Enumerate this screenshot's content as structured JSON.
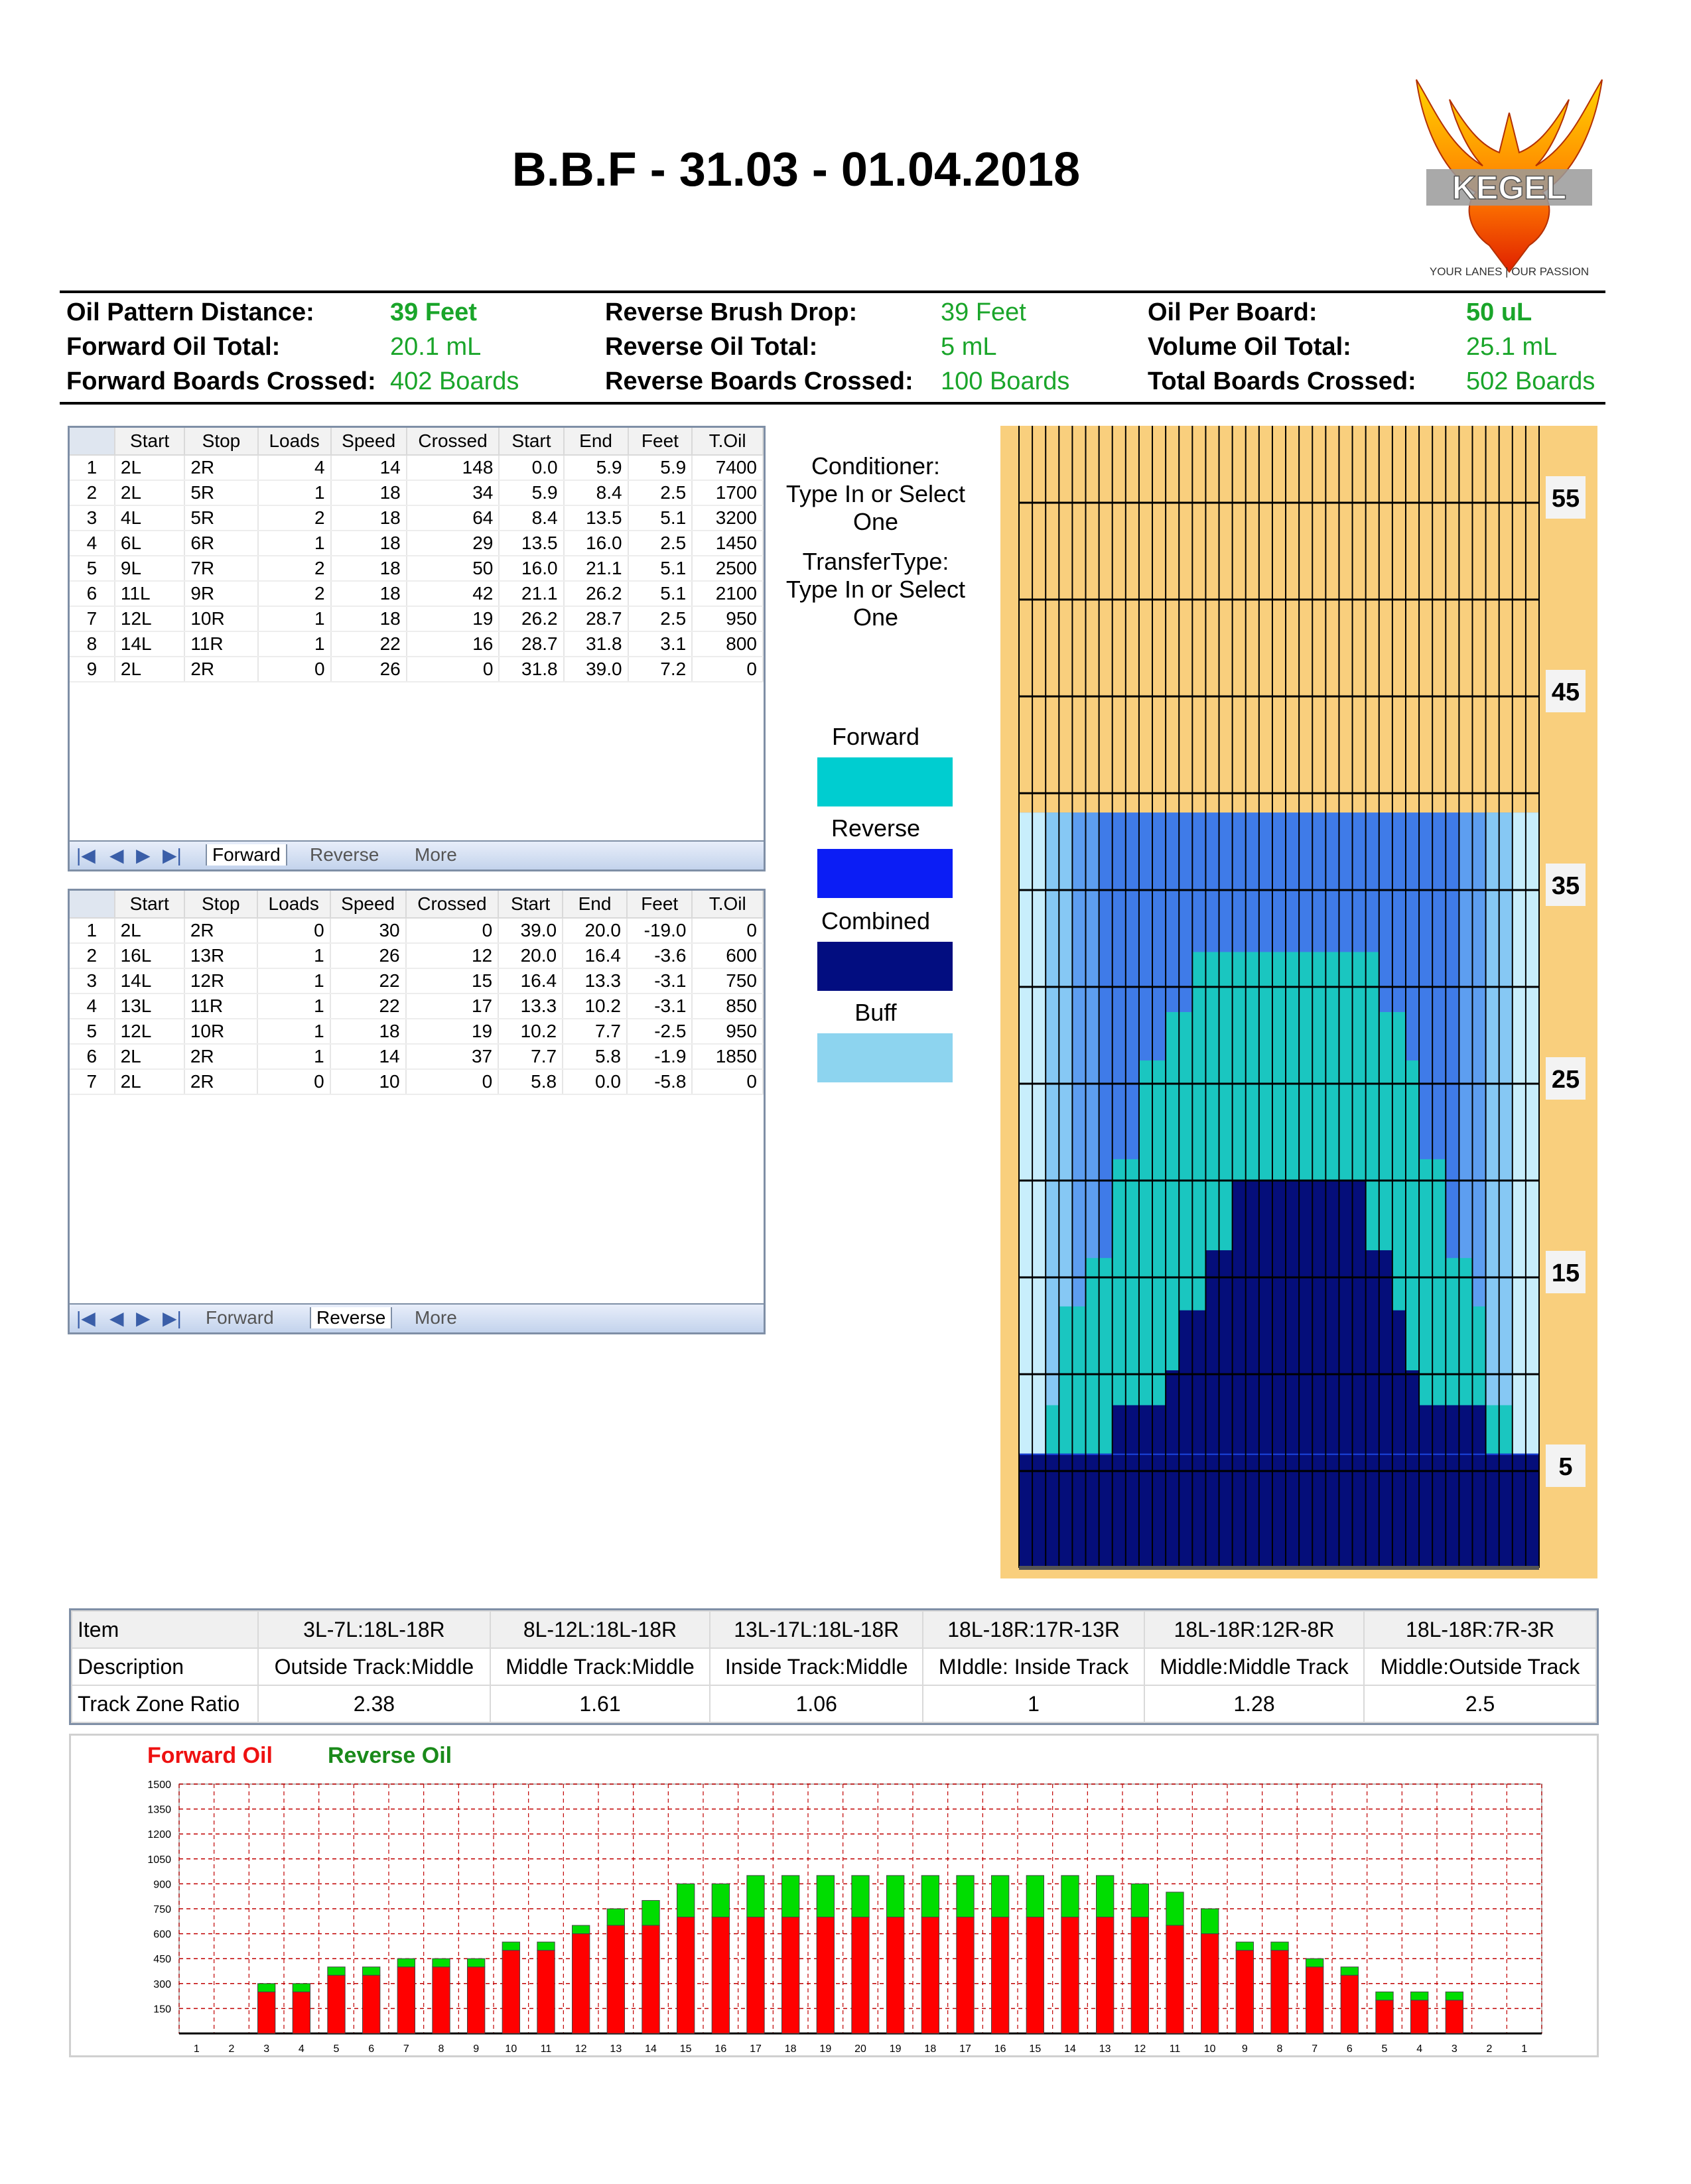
{
  "title": "B.B.F - 31.03 - 01.04.2018",
  "logo": {
    "brand": "KEGEL",
    "tagline": "YOUR LANES | OUR PASSION"
  },
  "summary": {
    "col1": [
      {
        "label": "Oil Pattern Distance:",
        "value": "39 Feet"
      },
      {
        "label": "Forward Oil Total:",
        "value": "20.1 mL"
      },
      {
        "label": "Forward Boards Crossed:",
        "value": "402 Boards"
      }
    ],
    "col2": [
      {
        "label": "Reverse Brush Drop:",
        "value": "39 Feet"
      },
      {
        "label": "Reverse Oil Total:",
        "value": "5 mL"
      },
      {
        "label": "Reverse Boards Crossed:",
        "value": "100 Boards"
      }
    ],
    "col3": [
      {
        "label": "Oil Per Board:",
        "value": "50 uL"
      },
      {
        "label": "Volume Oil Total:",
        "value": "25.1 mL"
      },
      {
        "label": "Total Boards Crossed:",
        "value": "502 Boards"
      }
    ]
  },
  "table_headers": [
    "Start",
    "Stop",
    "Loads",
    "Speed",
    "Crossed",
    "Start",
    "End",
    "Feet",
    "T.Oil"
  ],
  "forward_table": [
    [
      "2L",
      "2R",
      "4",
      "14",
      "148",
      "0.0",
      "5.9",
      "5.9",
      "7400"
    ],
    [
      "2L",
      "5R",
      "1",
      "18",
      "34",
      "5.9",
      "8.4",
      "2.5",
      "1700"
    ],
    [
      "4L",
      "5R",
      "2",
      "18",
      "64",
      "8.4",
      "13.5",
      "5.1",
      "3200"
    ],
    [
      "6L",
      "6R",
      "1",
      "18",
      "29",
      "13.5",
      "16.0",
      "2.5",
      "1450"
    ],
    [
      "9L",
      "7R",
      "2",
      "18",
      "50",
      "16.0",
      "21.1",
      "5.1",
      "2500"
    ],
    [
      "11L",
      "9R",
      "2",
      "18",
      "42",
      "21.1",
      "26.2",
      "5.1",
      "2100"
    ],
    [
      "12L",
      "10R",
      "1",
      "18",
      "19",
      "26.2",
      "28.7",
      "2.5",
      "950"
    ],
    [
      "14L",
      "11R",
      "1",
      "22",
      "16",
      "28.7",
      "31.8",
      "3.1",
      "800"
    ],
    [
      "2L",
      "2R",
      "0",
      "26",
      "0",
      "31.8",
      "39.0",
      "7.2",
      "0"
    ]
  ],
  "reverse_table": [
    [
      "2L",
      "2R",
      "0",
      "30",
      "0",
      "39.0",
      "20.0",
      "-19.0",
      "0"
    ],
    [
      "16L",
      "13R",
      "1",
      "26",
      "12",
      "20.0",
      "16.4",
      "-3.6",
      "600"
    ],
    [
      "14L",
      "12R",
      "1",
      "22",
      "15",
      "16.4",
      "13.3",
      "-3.1",
      "750"
    ],
    [
      "13L",
      "11R",
      "1",
      "22",
      "17",
      "13.3",
      "10.2",
      "-3.1",
      "850"
    ],
    [
      "12L",
      "10R",
      "1",
      "18",
      "19",
      "10.2",
      "7.7",
      "-2.5",
      "950"
    ],
    [
      "2L",
      "2R",
      "1",
      "14",
      "37",
      "7.7",
      "5.8",
      "-1.9",
      "1850"
    ],
    [
      "2L",
      "2R",
      "0",
      "10",
      "0",
      "5.8",
      "0.0",
      "-5.8",
      "0"
    ]
  ],
  "tabs": [
    "Forward",
    "Reverse",
    "More"
  ],
  "conditioner_text": [
    "Conditioner:",
    "Type In or Select",
    "One"
  ],
  "transfer_text": [
    "TransferType:",
    "Type In or Select",
    "One"
  ],
  "legend": [
    {
      "label": "Forward",
      "color": "#00cdd0"
    },
    {
      "label": "Reverse",
      "color": "#0b1df5"
    },
    {
      "label": "Combined",
      "color": "#020d80"
    },
    {
      "label": "Buff",
      "color": "#8dd4ef"
    }
  ],
  "lane_graph": {
    "scale_labels": [
      "55",
      "45",
      "35",
      "25",
      "15",
      "5"
    ],
    "colors": {
      "background": "#f9cf7d",
      "reverse_light": "#3f7be8",
      "reverse_dark": "#1b45dc",
      "buff": "#c8eefc",
      "forward": "#1ac6c0",
      "combined": "#050e7a"
    }
  },
  "ratio_table": {
    "header": [
      "Item",
      "3L-7L:18L-18R",
      "8L-12L:18L-18R",
      "13L-17L:18L-18R",
      "18L-18R:17R-13R",
      "18L-18R:12R-8R",
      "18L-18R:7R-3R"
    ],
    "description": [
      "Description",
      "Outside Track:Middle",
      "Middle Track:Middle",
      "Inside Track:Middle",
      "MIddle: Inside Track",
      "Middle:Middle Track",
      "Middle:Outside Track"
    ],
    "ratio": [
      "Track Zone Ratio",
      "2.38",
      "1.61",
      "1.06",
      "1",
      "1.28",
      "2.5"
    ]
  },
  "chart_data": {
    "type": "bar",
    "stacked": true,
    "title": "",
    "series": [
      {
        "name": "Forward Oil",
        "color": "#ff0000",
        "values": [
          0,
          250,
          250,
          350,
          350,
          400,
          400,
          400,
          500,
          500,
          600,
          650,
          650,
          700,
          700,
          700,
          700,
          700,
          700,
          700,
          700,
          700,
          700,
          700,
          700,
          700,
          700,
          650,
          600,
          500,
          500,
          400,
          350,
          200,
          200,
          200,
          0
        ]
      },
      {
        "name": "Reverse Oil",
        "color": "#00dd00",
        "values": [
          0,
          50,
          50,
          50,
          50,
          50,
          50,
          50,
          50,
          50,
          50,
          100,
          150,
          200,
          200,
          250,
          250,
          250,
          250,
          250,
          250,
          250,
          250,
          250,
          250,
          250,
          200,
          200,
          150,
          50,
          50,
          50,
          50,
          50,
          50,
          50,
          0
        ]
      }
    ],
    "categories": [
      "1",
      "2",
      "3",
      "4",
      "5",
      "6",
      "7",
      "8",
      "9",
      "10",
      "11",
      "12",
      "13",
      "14",
      "15",
      "16",
      "17",
      "18",
      "19",
      "20",
      "19",
      "18",
      "17",
      "16",
      "15",
      "14",
      "13",
      "12",
      "11",
      "10",
      "9",
      "8",
      "7",
      "6",
      "5",
      "4",
      "3",
      "2",
      "1"
    ],
    "bar_boards": [
      "2",
      "3",
      "4",
      "5",
      "6",
      "7",
      "8",
      "9",
      "10",
      "11",
      "12",
      "13",
      "14",
      "15",
      "16",
      "17",
      "18",
      "19",
      "20",
      "19",
      "18",
      "17",
      "16",
      "15",
      "14",
      "13",
      "12",
      "11",
      "10",
      "9",
      "8",
      "7",
      "6",
      "5",
      "4",
      "3",
      "2"
    ],
    "yticks": [
      150,
      300,
      450,
      600,
      750,
      900,
      1050,
      1200,
      1350,
      1500
    ],
    "ylim": [
      0,
      1500
    ],
    "grid": true
  }
}
